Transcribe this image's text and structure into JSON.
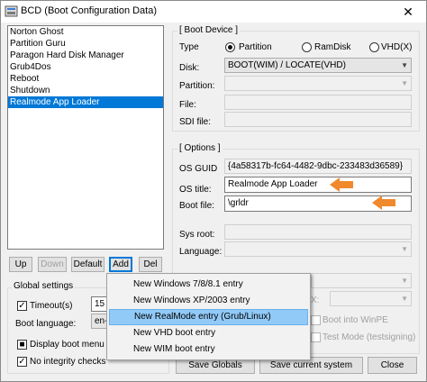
{
  "window": {
    "title": "BCD (Boot Configuration Data)",
    "close_glyph": "✕"
  },
  "list": {
    "items": [
      "Norton Ghost",
      "Partition Guru",
      "Paragon Hard Disk Manager",
      "Grub4Dos",
      "Reboot",
      "Shutdown",
      "Realmode App Loader"
    ],
    "selected_index": 6
  },
  "list_buttons": {
    "up": "Up",
    "down": "Down",
    "default": "Default",
    "add": "Add",
    "del": "Del"
  },
  "boot_device": {
    "group_title": "[ Boot Device ]",
    "type_label": "Type",
    "radio_partition": "Partition",
    "radio_ramdisk": "RamDisk",
    "radio_vhd": "VHD(X)",
    "disk_label": "Disk:",
    "disk_value": "BOOT(WIM) / LOCATE(VHD)",
    "partition_label": "Partition:",
    "file_label": "File:",
    "sdi_label": "SDI file:"
  },
  "options": {
    "group_title": "[ Options ]",
    "os_guid_label": "OS GUID",
    "os_guid_value": "{4a58317b-fc64-4482-9dbc-233483d36589}",
    "os_title_label": "OS title:",
    "os_title_value": "Realmode App Loader",
    "boot_file_label": "Boot file:",
    "boot_file_value": "\\grldr",
    "sys_root_label": "Sys root:",
    "language_label": "Language:",
    "partial_label": "X:",
    "boot_winpe": "Boot into WinPE",
    "test_mode": "Test Mode (testsigning)"
  },
  "global": {
    "group_title": "Global settings",
    "timeout_label": "Timeout(s)",
    "timeout_value": "15",
    "boot_language_label": "Boot language:",
    "boot_language_value": "en-",
    "display_boot_menu": "Display boot menu",
    "no_integrity_checks": "No integrity checks"
  },
  "bottom_buttons": {
    "save_globals": "Save Globals",
    "save_current": "Save current system",
    "close": "Close"
  },
  "context_menu": {
    "items": [
      "New Windows 7/8/8.1 entry",
      "New Windows XP/2003 entry",
      "New RealMode entry (Grub/Linux)",
      "New VHD boot entry",
      "New WIM boot entry"
    ],
    "highlighted_index": 2
  },
  "colors": {
    "selection": "#0078d7",
    "menu_highlight": "#91c9f7",
    "arrow": "#f0892c"
  }
}
